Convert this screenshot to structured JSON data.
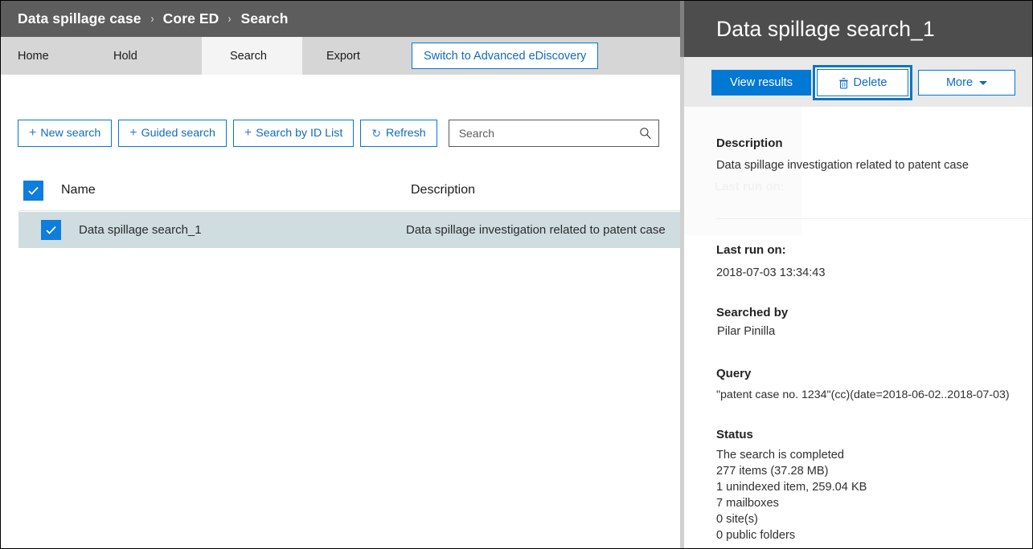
{
  "breadcrumb": {
    "items": [
      "Data spillage case",
      "Core ED",
      "Search"
    ],
    "separator": "›"
  },
  "nav": {
    "tabs": [
      {
        "label": "Home",
        "active": false
      },
      {
        "label": "Hold",
        "active": false
      },
      {
        "label": "Search",
        "active": true
      },
      {
        "label": "Export",
        "active": false
      }
    ],
    "switch_button_label": "Switch to Advanced eDiscovery"
  },
  "toolbar": {
    "new_search_label": "New search",
    "guided_search_label": "Guided search",
    "search_by_id_label": "Search by ID List",
    "refresh_label": "Refresh",
    "plus_glyph": "+",
    "refresh_glyph": "↻"
  },
  "search": {
    "placeholder": "Search",
    "value": "",
    "icon": "search-icon"
  },
  "list": {
    "columns": [
      "Name",
      "Description"
    ],
    "header_checkbox_checked": true,
    "rows": [
      {
        "name": "Data spillage search_1",
        "description": "Data spillage investigation related to patent case",
        "checked": true,
        "selected": true
      }
    ]
  },
  "panel": {
    "title": "Data spillage search_1",
    "actions": {
      "view_results_label": "View results",
      "delete_label": "Delete",
      "delete_icon": "trash-icon",
      "delete_focused": true,
      "more_label": "More",
      "more_caret": "chevron-down-icon"
    },
    "details": {
      "description_label": "Description",
      "description_value": "Data spillage investigation related to patent case",
      "ghost_text": "Last run on:",
      "last_run_label": "Last run on:",
      "last_run_value": "2018-07-03 13:34:43",
      "searched_by_label": "Searched by",
      "searched_by_value": "Pilar Pinilla",
      "query_label": "Query",
      "query_value": "\"patent case no. 1234\"(cc)(date=2018-06-02..2018-07-03)",
      "status_label": "Status",
      "status_lines": [
        "The search is completed",
        "277 items (37.28 MB)",
        "1 unindexed item, 259.04 KB",
        "7 mailboxes",
        "0 site(s)",
        "0 public folders"
      ]
    }
  },
  "colors": {
    "accent": "#0078d4",
    "link": "#0f6cbd",
    "breadcrumb_bar": "#5d5d5d",
    "panel_header": "#4d4d4d",
    "nav_strip": "#d6d6d6",
    "active_tab": "#f4f4f4",
    "row_selected": "#cfdde1",
    "checkbox": "#0f7ddb",
    "focus_ring": "#0f75bd",
    "action_bar": "#e9e9e9"
  }
}
